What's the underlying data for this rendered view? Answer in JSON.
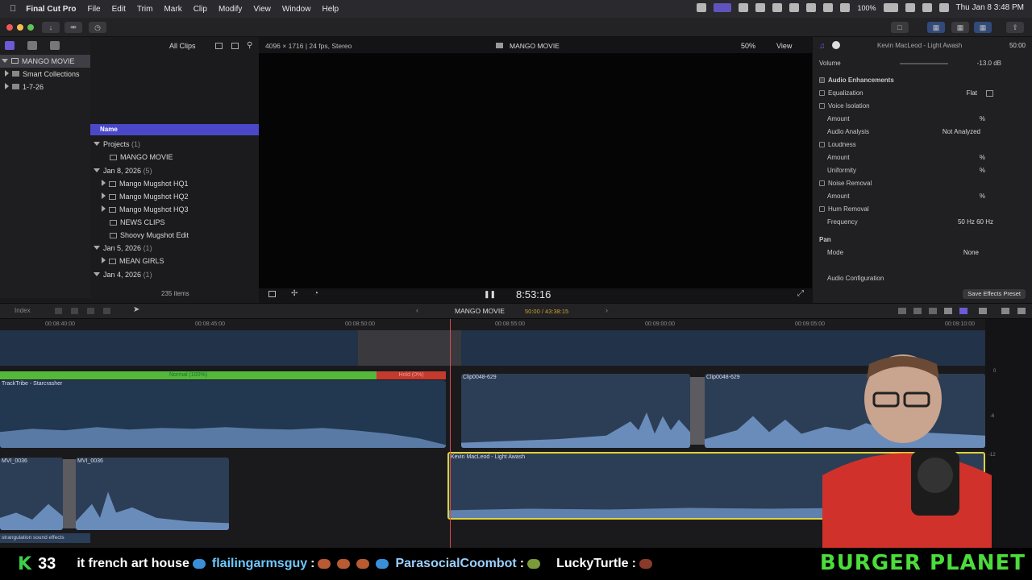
{
  "menubar": {
    "app": "Final Cut Pro",
    "menus": [
      "File",
      "Edit",
      "Trim",
      "Mark",
      "Clip",
      "Modify",
      "View",
      "Window",
      "Help"
    ],
    "battery": "100%",
    "datetime": "Thu Jan 8  3:48 PM"
  },
  "library": {
    "items": [
      {
        "label": "MANGO MOVIE"
      },
      {
        "label": "Smart Collections"
      },
      {
        "label": "1-7-26"
      }
    ]
  },
  "browser": {
    "filter": "All Clips",
    "column_header": "Name",
    "rows": [
      {
        "label": "Projects",
        "count": "(1)",
        "type": "group"
      },
      {
        "label": "MANGO MOVIE",
        "type": "item"
      },
      {
        "label": "Jan 8, 2026",
        "count": "(5)",
        "type": "group"
      },
      {
        "label": "Mango Mugshot HQ1",
        "type": "clip"
      },
      {
        "label": "Mango Mugshot HQ2",
        "type": "clip"
      },
      {
        "label": "Mango Mugshot HQ3",
        "type": "clip"
      },
      {
        "label": "NEWS CLIPS",
        "type": "item"
      },
      {
        "label": "Shoovy Mugshot Edit",
        "type": "item"
      },
      {
        "label": "Jan 5, 2026",
        "count": "(1)",
        "type": "group"
      },
      {
        "label": "MEAN GIRLS",
        "type": "clip"
      },
      {
        "label": "Jan 4, 2026",
        "count": "(1)",
        "type": "group"
      }
    ],
    "item_count": "235 items"
  },
  "viewer": {
    "format": "4096 × 1716 | 24 fps, Stereo",
    "title": "MANGO MOVIE",
    "zoom": "50%",
    "view_label": "View",
    "timecode": "8:53:16"
  },
  "inspector": {
    "clip_name": "Kevin MacLeod - Light Awash",
    "clip_duration": "50:00",
    "volume_label": "Volume",
    "volume_value": "-13.0 dB",
    "section": "Audio Enhancements",
    "rows": [
      {
        "label": "Equalization",
        "value": "Flat",
        "check": true
      },
      {
        "label": "Voice Isolation",
        "check": true
      },
      {
        "label": "Amount",
        "value": "%",
        "indent": true
      },
      {
        "label": "Audio Analysis",
        "value": "Not Analyzed",
        "indent": true
      },
      {
        "label": "Loudness",
        "check": true
      },
      {
        "label": "Amount",
        "value": "%",
        "indent": true
      },
      {
        "label": "Uniformity",
        "value": "%",
        "indent": true
      },
      {
        "label": "Noise Removal",
        "check": true
      },
      {
        "label": "Amount",
        "value": "%",
        "indent": true
      },
      {
        "label": "Hum Removal",
        "check": true
      },
      {
        "label": "Frequency",
        "value": "50 Hz    60 Hz",
        "indent": true
      }
    ],
    "pan_label": "Pan",
    "mode_label": "Mode",
    "mode_value": "None",
    "config_label": "Audio Configuration",
    "save_preset": "Save Effects Preset"
  },
  "timeline": {
    "index_label": "Index",
    "project": "MANGO MOVIE",
    "duration": "50:00 / 43:38:15",
    "ruler_ticks": [
      "00:08:40:00",
      "00:08:45:00",
      "00:08:50:00",
      "00:08:55:00",
      "00:09:00:00",
      "00:09:05:00",
      "00:09:10:00"
    ],
    "speed_normal": "Normal (100%)",
    "speed_hold": "Hold (0%)",
    "clips": {
      "trackribe": "TrackTribe - Starcrasher",
      "clip1": "Clip0048-629",
      "clip2": "Clip0048-629",
      "mvi1": "MVI_0036",
      "mvi2": "MVI_0036",
      "kevin": "Kevin MacLeod - Light Awash",
      "sfx": "strangulation sound effects"
    },
    "meter_labels": [
      "0",
      "-6",
      "-12"
    ]
  },
  "stream": {
    "k_count": "33",
    "ticker_a": "it french art house",
    "user_a": "flailingarmsguy",
    "user_b": "ParasocialCoombot",
    "user_c": "LuckyTurtle",
    "banner": "BURGER PLANET"
  }
}
